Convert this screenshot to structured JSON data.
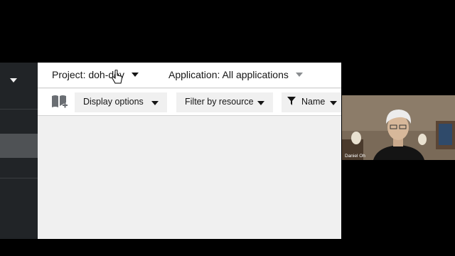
{
  "context_bar": {
    "project_label": "Project: doh-dev",
    "application_label": "Application: All applications"
  },
  "toolbar": {
    "display_options": "Display options",
    "filter_by_resource": "Filter by resource",
    "name_filter": "Name"
  },
  "webcam": {
    "participant_name": "Daniel Oh"
  },
  "icons": {
    "topology_quick_search": "book-plus-icon",
    "filter": "filter-icon",
    "dropdown": "caret-down-icon"
  },
  "colors": {
    "nav_background": "#212427",
    "nav_selected": "#4f5255",
    "workspace_background": "#f0f0f0",
    "text": "#151515"
  }
}
